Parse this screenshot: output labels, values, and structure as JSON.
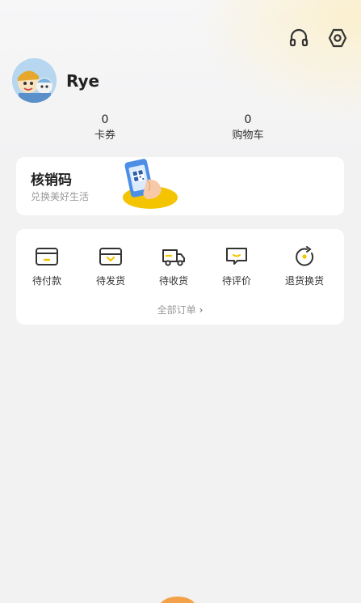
{
  "header": {
    "icons": [
      "headset-icon",
      "settings-icon"
    ]
  },
  "profile": {
    "username": "Rye"
  },
  "stats": {
    "coupons": {
      "count": "0",
      "label": "卡券"
    },
    "cart": {
      "count": "0",
      "label": "购物车"
    }
  },
  "verify": {
    "title": "核销码",
    "subtitle": "兑换美好生活"
  },
  "orders": {
    "items": [
      {
        "label": "待付款",
        "icon": "wallet-icon"
      },
      {
        "label": "待发货",
        "icon": "package-icon"
      },
      {
        "label": "待收货",
        "icon": "truck-icon"
      },
      {
        "label": "待评价",
        "icon": "comment-icon"
      },
      {
        "label": "退货换货",
        "icon": "return-icon"
      }
    ],
    "all_label": "全部订单"
  },
  "colors": {
    "accent": "#f5c400",
    "icon_stroke": "#333333",
    "card_bg": "#ffffff",
    "page_bg": "#f2f2f3",
    "bottom_accent": "#f3a24a"
  }
}
